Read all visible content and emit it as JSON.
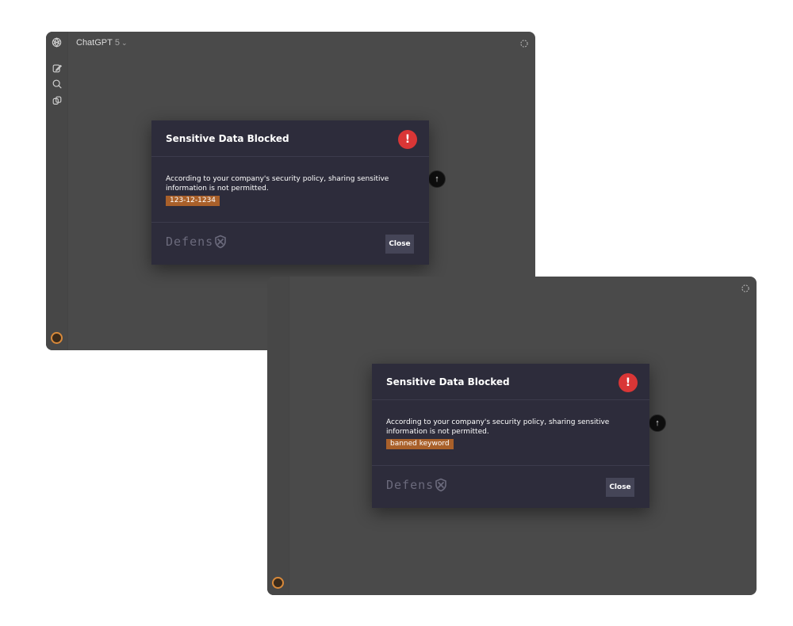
{
  "colors": {
    "window_bg": "#4a4a4a",
    "modal_bg": "#2d2c3b",
    "alert": "#d93636",
    "flag": "#a9602a",
    "close_button": "#454557"
  },
  "screenshot_a": {
    "app_title": "ChatGPT",
    "model_version": "5",
    "sidebar_icons": [
      "new-chat-icon",
      "search-icon",
      "library-icon"
    ],
    "modal": {
      "title": "Sensitive Data Blocked",
      "alert_glyph": "!",
      "message": "According to your company's security policy, sharing sensitive information is not permitted.",
      "flagged_value": "123-12-1234",
      "brand": "Defens",
      "close_label": "Close"
    }
  },
  "screenshot_b": {
    "modal": {
      "title": "Sensitive Data Blocked",
      "alert_glyph": "!",
      "message": "According to your company's security policy, sharing sensitive information is not permitted.",
      "flagged_value": "banned keyword",
      "brand": "Defens",
      "close_label": "Close"
    }
  }
}
